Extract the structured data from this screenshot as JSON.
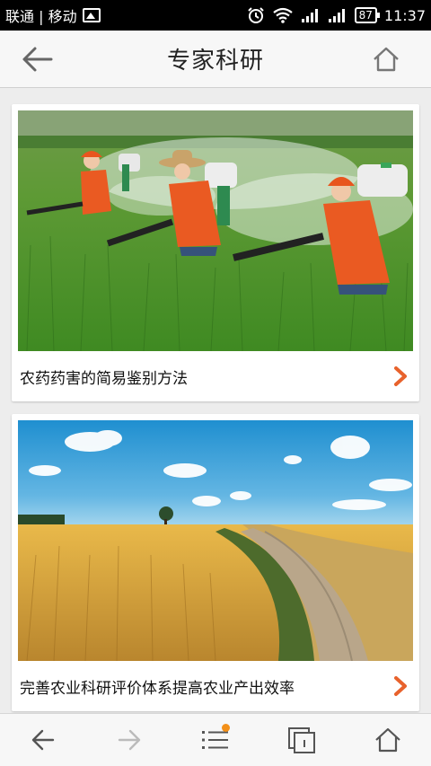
{
  "statusbar": {
    "carrier": "联通 | 移动",
    "battery": "87",
    "time": "11:37"
  },
  "header": {
    "title": "专家科研"
  },
  "articles": [
    {
      "caption": "农药药害的简易鉴别方法",
      "image": "farmers-spraying-pesticide-photo"
    },
    {
      "caption": "完善农业科研评价体系提高农业产出效率",
      "image": "wheat-field-road-photo"
    }
  ],
  "colors": {
    "accent": "#e8622c",
    "notification_dot": "#f39019"
  }
}
